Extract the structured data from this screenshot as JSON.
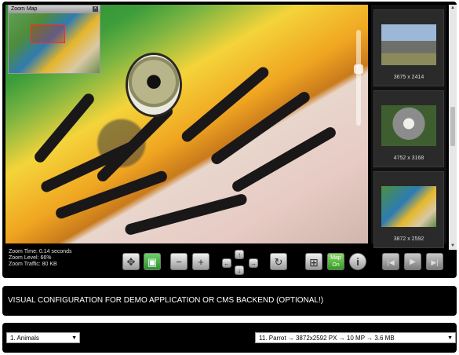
{
  "zoom_map": {
    "title": "Zoom Map",
    "close_label": "×"
  },
  "thumbnails": [
    {
      "label": "3675 x 2414",
      "subject": "rhinos"
    },
    {
      "label": "4752 x 3168",
      "subject": "owl"
    },
    {
      "label": "3872 x 2592",
      "subject": "parrot"
    }
  ],
  "stats": {
    "zoom_time": "Zoom Time: 0.14 seconds",
    "zoom_level": "Zoom Level: 66%",
    "zoom_traffic": "Zoom Traffic: 80 KB"
  },
  "toolbar": {
    "pan_icon": "✥",
    "map_text": "Map On",
    "zoom_out": "−",
    "zoom_in": "+",
    "up": "↑",
    "down": "↓",
    "left": "←",
    "right": "→",
    "reset": "↻",
    "info": "i",
    "first": "|◀",
    "play": "▶",
    "last": "▶|"
  },
  "config_text": "VISUAL CONFIGURATION FOR DEMO APPLICATION OR CMS BACKEND (OPTIONAL!)",
  "selects": {
    "category": "1. Animals",
    "image": "11. Parrot → 3872x2592 PX → 10 MP → 3.6 MB"
  }
}
